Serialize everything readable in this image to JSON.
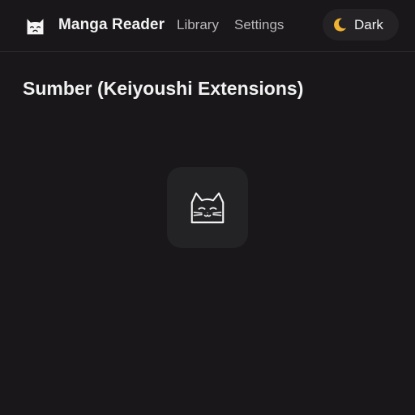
{
  "header": {
    "app_name": "Manga Reader",
    "nav": {
      "library": "Library",
      "settings": "Settings"
    },
    "theme_toggle": {
      "label": "Dark",
      "icon": "moon-icon"
    }
  },
  "main": {
    "title": "Sumber (Keiyoushi Extensions)",
    "placeholder_icon": "cat-face-icon"
  },
  "colors": {
    "background": "#19171a",
    "card": "#232224",
    "moon": "#f0b232"
  }
}
